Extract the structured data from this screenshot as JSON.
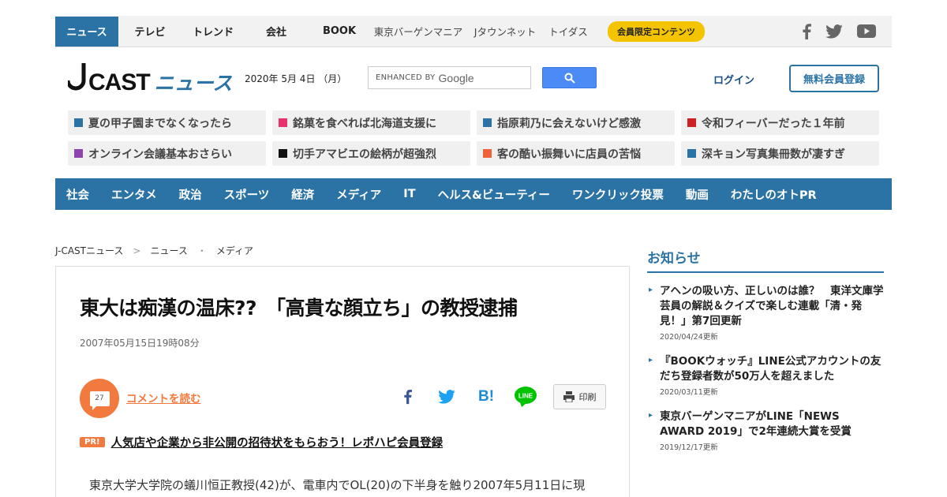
{
  "topnav": {
    "items": [
      {
        "label": "ニュース"
      },
      {
        "label": "テレビ"
      },
      {
        "label": "トレンド"
      },
      {
        "label": "会社"
      },
      {
        "label": "BOOK"
      },
      {
        "label": "東京バーゲンマニア"
      },
      {
        "label": "Jタウンネット"
      },
      {
        "label": "トイダス"
      }
    ],
    "member_label": "会員限定コンテンツ",
    "social_icons": [
      "facebook-icon",
      "twitter-icon",
      "youtube-icon"
    ]
  },
  "header": {
    "logo_main": "J-CAST",
    "logo_sub": "ニュース",
    "date": "2020年 5月 4日 （月）",
    "search_enhanced": "ENHANCED BY",
    "search_brand": "Google",
    "login_label": "ログイン",
    "register_label": "無料会員登録"
  },
  "tags": [
    {
      "label": "夏の甲子園までなくなったら",
      "color": "#2b73a5"
    },
    {
      "label": "銘菓を食べれば北海道支援に",
      "color": "#e8326e"
    },
    {
      "label": "指原莉乃に会えないけど感激",
      "color": "#2b73a5"
    },
    {
      "label": "令和フィーバーだった１年前",
      "color": "#cc2222"
    },
    {
      "label": "オンライン会議基本おさらい",
      "color": "#8e44ad"
    },
    {
      "label": "切手アマビエの絵柄が超強烈",
      "color": "#111111"
    },
    {
      "label": "客の酷い振舞いに店員の苦悩",
      "color": "#f0623a"
    },
    {
      "label": "深キョン写真集冊数が凄すぎ",
      "color": "#2b73a5"
    }
  ],
  "catnav": [
    {
      "label": "社会"
    },
    {
      "label": "エンタメ"
    },
    {
      "label": "政治"
    },
    {
      "label": "スポーツ"
    },
    {
      "label": "経済"
    },
    {
      "label": "メディア"
    },
    {
      "label": "IT"
    },
    {
      "label": "ヘルス&ビューティー"
    },
    {
      "label": "ワンクリック投票"
    },
    {
      "label": "動画"
    },
    {
      "label": "わたしのオトPR"
    }
  ],
  "breadcrumb": {
    "home": "J-CASTニュース",
    "sep1": ">",
    "section": "ニュース",
    "sep2": "・",
    "category": "メディア"
  },
  "article": {
    "title": "東大は痴漢の温床??　「高貴な顔立ち」の教授逮捕",
    "date": "2007年05月15日19時08分",
    "comment_count": "27",
    "comment_label": "コメントを読む",
    "share_icons": [
      "facebook-icon",
      "twitter-icon",
      "hatena-bookmark-icon",
      "line-icon"
    ],
    "line_label": "LINE",
    "hatena_label": "B!",
    "print_label": "印刷",
    "pr_badge": "PR!",
    "pr_link": "人気店や企業から非公開の招待状をもらおう！レポハピ会員登録",
    "body_first_line": "東京大学大学院の蟻川恒正教授(42)が、電車内でOL(20)の下半身を触り2007年5月11日に現"
  },
  "sidebar": {
    "heading": "お知らせ",
    "items": [
      {
        "text": "アヘンの吸い方、正しいのは誰？　東洋文庫学芸員の解説＆クイズで楽しむ連載「清・発見！」第7回更新",
        "date": "2020/04/24更新"
      },
      {
        "text": "『BOOKウォッチ』LINE公式アカウントの友だち登録者数が50万人を超えました",
        "date": "2020/03/11更新"
      },
      {
        "text": "東京バーゲンマニアがLINE「NEWS AWARD 2019」で2年連続大賞を受賞",
        "date": "2019/12/17更新"
      }
    ]
  }
}
